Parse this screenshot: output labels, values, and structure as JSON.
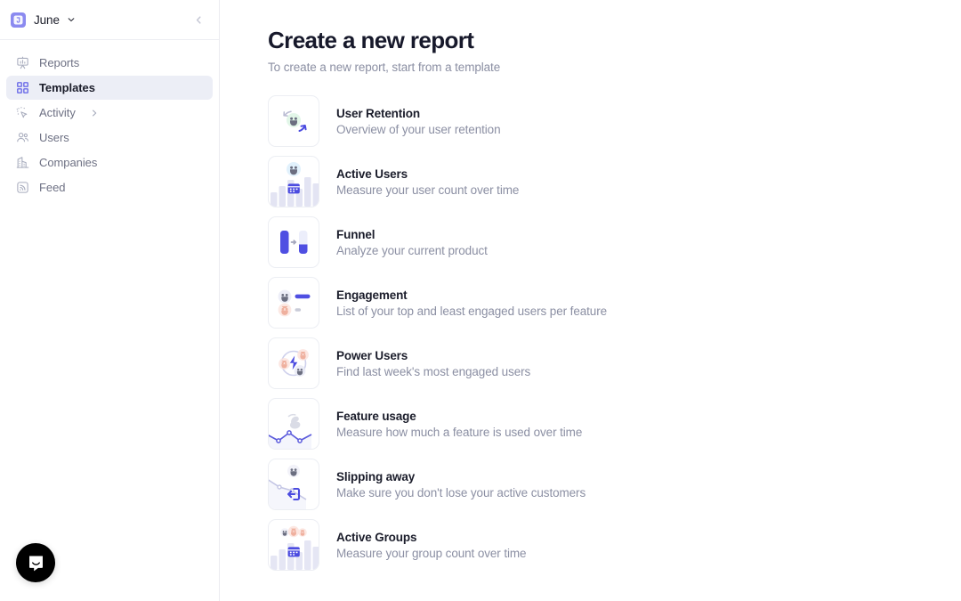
{
  "sidebar": {
    "workspace": {
      "name": "June",
      "logo_icon": "june-logo-icon",
      "caret_icon": "chevron-down-icon"
    },
    "collapse_icon": "chevron-left-icon",
    "items": [
      {
        "label": "Reports",
        "icon": "presentation-chart-icon",
        "active": false,
        "has_chevron": false
      },
      {
        "label": "Templates",
        "icon": "grid-squares-icon",
        "active": true,
        "has_chevron": false
      },
      {
        "label": "Activity",
        "icon": "cursor-sparkle-icon",
        "active": false,
        "has_chevron": true
      },
      {
        "label": "Users",
        "icon": "users-icon",
        "active": false,
        "has_chevron": false
      },
      {
        "label": "Companies",
        "icon": "building-icon",
        "active": false,
        "has_chevron": false
      },
      {
        "label": "Feed",
        "icon": "rss-feed-icon",
        "active": false,
        "has_chevron": false
      }
    ],
    "launcher": {
      "icon": "intercom-chat-icon",
      "aria": "Open Intercom Messenger"
    }
  },
  "main": {
    "title": "Create a new report",
    "subtitle": "To create a new report, start from a template",
    "templates": [
      {
        "name": "User Retention",
        "desc": "Overview of your user retention",
        "icon": "retention-loop-icon"
      },
      {
        "name": "Active Users",
        "desc": "Measure your user count over time",
        "icon": "bar-chart-calendar-icon"
      },
      {
        "name": "Funnel",
        "desc": "Analyze your current product",
        "icon": "funnel-bars-icon"
      },
      {
        "name": "Engagement",
        "desc": "List of your top and least engaged users per feature",
        "icon": "engagement-list-icon"
      },
      {
        "name": "Power Users",
        "desc": "Find last week's most engaged users",
        "icon": "power-bolt-icon"
      },
      {
        "name": "Feature usage",
        "desc": "Measure how much a feature is used over time",
        "icon": "line-chart-hand-icon"
      },
      {
        "name": "Slipping away",
        "desc": "Make sure you don't lose your active customers",
        "icon": "declining-line-exit-icon"
      },
      {
        "name": "Active Groups",
        "desc": "Measure your group count over time",
        "icon": "bar-chart-groups-icon"
      }
    ]
  },
  "colors": {
    "accent": "#5c5ce0",
    "accent_soft": "#8b8af0",
    "active_bg": "#eceef6",
    "text_primary": "#1b1d2b",
    "text_muted": "#8b8fa3",
    "border": "#ebecf0",
    "launcher_bg": "#000000"
  }
}
